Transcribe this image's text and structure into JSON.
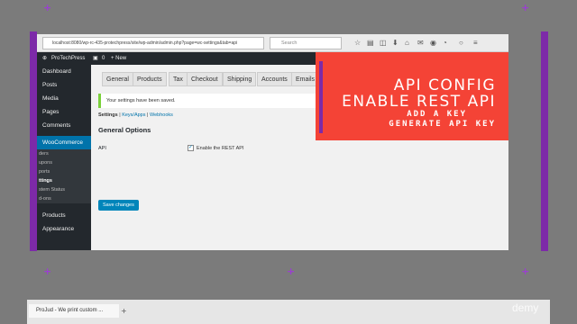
{
  "browser": {
    "url": "localhost:8080/wp-rc-435-protechpress/site/wp-admin/admin.php?page=wc-settings&tab=api",
    "search_placeholder": "Search"
  },
  "admin_bar": {
    "site_name": "ProTechPress",
    "comment_count": "0",
    "new_label": "+ New"
  },
  "sidebar": {
    "items": [
      "Dashboard",
      "Posts",
      "Media",
      "Pages",
      "Comments"
    ],
    "active": "WooCommerce",
    "sub_items": [
      "ders",
      "upons",
      "ports",
      "ttings",
      "stem Status",
      "d-ons"
    ],
    "bottom_items": [
      "Products",
      "Appearance"
    ]
  },
  "tabs": [
    "General",
    "Products",
    "Tax",
    "Checkout",
    "Shipping",
    "Accounts",
    "Emails"
  ],
  "notice": "Your settings have been saved.",
  "sublinks": {
    "settings": "Settings",
    "sep1": "|",
    "keys": "Keys/Apps",
    "sep2": "|",
    "webhooks": "Webhooks"
  },
  "options_title": "General Options",
  "api_label": "API",
  "api_checkbox_label": "Enable the REST API",
  "save_button": "Save changes",
  "banner": {
    "line1": "API CONFIG",
    "line2": "ENABLE REST API",
    "line3": "ADD A KEY",
    "line4": "GENERATE API KEY"
  },
  "taskbar": {
    "tab_title": "ProJud - We print custom ...",
    "watermark": "demy"
  },
  "colors": {
    "banner": "#f44336",
    "accent_purple": "#7d2aa8",
    "wp_dark": "#23282d",
    "woo_active": "#0073aa",
    "save_blue": "#0085ba"
  }
}
